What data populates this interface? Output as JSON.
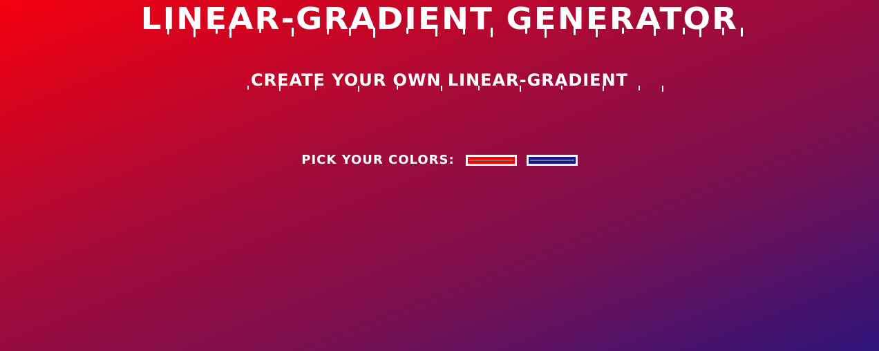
{
  "header": {
    "title": "LINEAR-GRADIENT GENERATOR",
    "subtitle": "CREATE YOUR OWN LINEAR-GRADIENT"
  },
  "picker": {
    "label": "PICK YOUR COLORS:",
    "color1": "#ff0000",
    "color2": "#11159b"
  },
  "background": {
    "direction": "to bottom right",
    "from": "#ff0000",
    "to": "#11159b"
  }
}
